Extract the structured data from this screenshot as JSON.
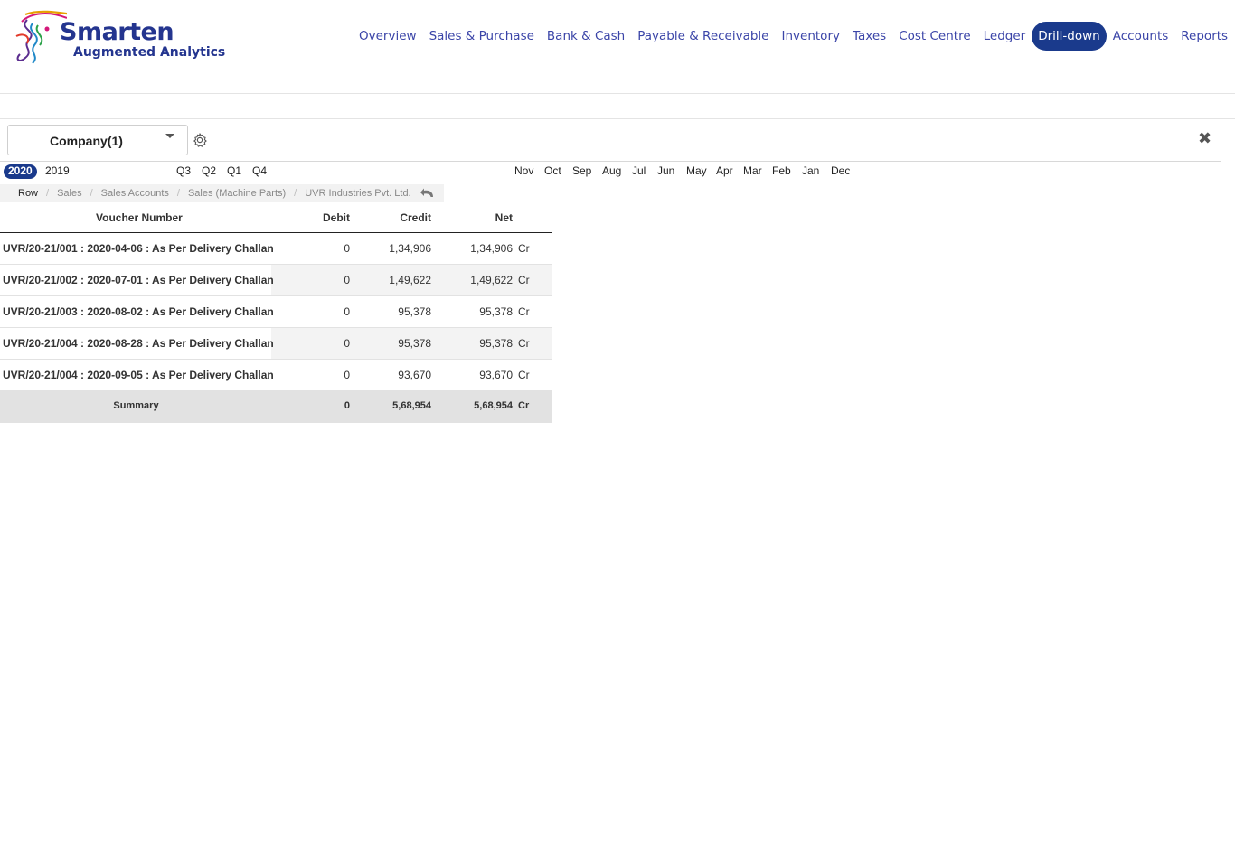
{
  "brand": {
    "name": "Smarten",
    "tagline": "Augmented Analytics",
    "colors": {
      "primary": "#24358f",
      "accent": "#1a3a8c"
    }
  },
  "nav": {
    "items": [
      {
        "label": "Overview",
        "active": false
      },
      {
        "label": "Sales & Purchase",
        "active": false
      },
      {
        "label": "Bank & Cash",
        "active": false
      },
      {
        "label": "Payable & Receivable",
        "active": false
      },
      {
        "label": "Inventory",
        "active": false
      },
      {
        "label": "Taxes",
        "active": false
      },
      {
        "label": "Cost Centre",
        "active": false
      },
      {
        "label": "Ledger",
        "active": false
      },
      {
        "label": "Drill-down",
        "active": true
      },
      {
        "label": "Accounts",
        "active": false
      },
      {
        "label": "Reports",
        "active": false
      }
    ]
  },
  "filter": {
    "company_label": "Company(1)",
    "settings_icon": "gear-icon",
    "close_icon": "close-icon"
  },
  "periods": {
    "years": [
      "2020",
      "2019"
    ],
    "selected_year": "2020",
    "quarters": [
      "Q3",
      "Q2",
      "Q1",
      "Q4"
    ],
    "months": [
      "Nov",
      "Oct",
      "Sep",
      "Aug",
      "Jul",
      "Jun",
      "May",
      "Apr",
      "Mar",
      "Feb",
      "Jan",
      "Dec"
    ]
  },
  "breadcrumb": {
    "items": [
      "Row",
      "Sales",
      "Sales Accounts",
      "Sales (Machine Parts)",
      "UVR Industries Pvt. Ltd."
    ],
    "back_icon": "undo-icon"
  },
  "table": {
    "headers": {
      "voucher": "Voucher Number",
      "debit": "Debit",
      "credit": "Credit",
      "net": "Net"
    },
    "rows": [
      {
        "voucher": "UVR/20-21/001 : 2020-04-06 : As Per Delivery Challan",
        "debit": "0",
        "credit": "1,34,906",
        "net": "1,34,906",
        "crdr": "Cr"
      },
      {
        "voucher": "UVR/20-21/002 : 2020-07-01 : As Per Delivery Challan",
        "debit": "0",
        "credit": "1,49,622",
        "net": "1,49,622",
        "crdr": "Cr"
      },
      {
        "voucher": "UVR/20-21/003 : 2020-08-02 : As Per Delivery Challan",
        "debit": "0",
        "credit": "95,378",
        "net": "95,378",
        "crdr": "Cr"
      },
      {
        "voucher": "UVR/20-21/004 : 2020-08-28 : As Per Delivery Challan",
        "debit": "0",
        "credit": "95,378",
        "net": "95,378",
        "crdr": "Cr"
      },
      {
        "voucher": "UVR/20-21/004 : 2020-09-05 : As Per Delivery Challan",
        "debit": "0",
        "credit": "93,670",
        "net": "93,670",
        "crdr": "Cr"
      }
    ],
    "summary": {
      "label": "Summary",
      "debit": "0",
      "credit": "5,68,954",
      "net": "5,68,954",
      "crdr": "Cr"
    }
  }
}
